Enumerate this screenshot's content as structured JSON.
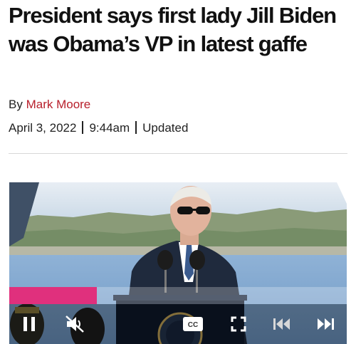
{
  "article": {
    "headline": "President says first lady Jill Biden was Obama’s VP in latest gaffe",
    "byline_prefix": "By",
    "author": "Mark Moore",
    "date": "April 3, 2022",
    "time": "9:44am",
    "updated_label": "Updated"
  },
  "video_player": {
    "progress_percent": 26,
    "state": "playing",
    "muted": true,
    "controls": [
      "pause-icon",
      "mute-icon",
      "captions-icon",
      "fullscreen-icon",
      "skip-back-icon",
      "skip-forward-icon"
    ],
    "progress_color": "#e0307d"
  },
  "colors": {
    "author_link": "#b8202c",
    "headline": "#111111"
  }
}
